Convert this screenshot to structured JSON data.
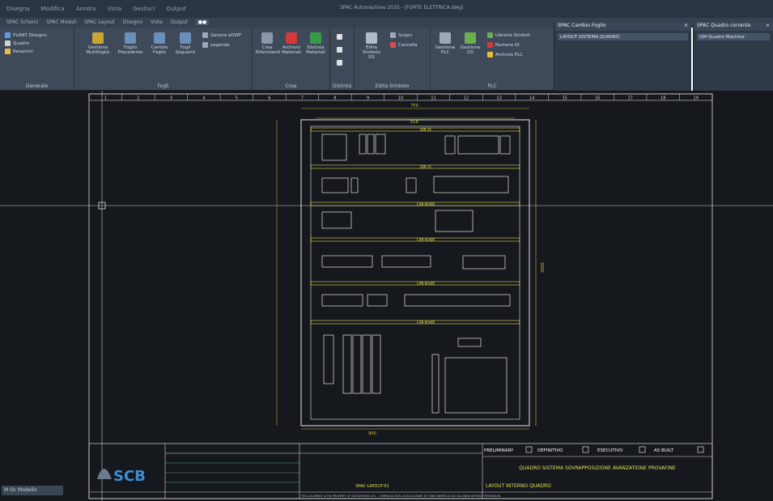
{
  "window": {
    "title": "SPAC Automazione 2025 - [FORTE ELETTRICA.dwg]",
    "quick_access": [
      "Disegna",
      "Modifica",
      "Annota",
      "Vista",
      "Gestisci",
      "Output"
    ]
  },
  "tabs": [
    "SPAC Schemi",
    "SPAC Moduli",
    "SPAC Layout",
    "Disegno",
    "Vista",
    "Output"
  ],
  "ribbon": {
    "groups": [
      {
        "label": "Generale",
        "items": [
          "PLANT Disegno",
          "Quadro",
          "Relazioni"
        ]
      },
      {
        "label": "Fogli",
        "items": [
          "Gestione Multifoglio",
          "Foglio Precedente",
          "Cambio Foglio",
          "Fogli Seguenti",
          "Genera eDWF",
          "Legenda"
        ]
      },
      {
        "label": "Crea",
        "items": [
          "Crea Riferimenti",
          "Archivio Materiali",
          "Distinta Materiali"
        ]
      },
      {
        "label": "Distinta",
        "items": []
      },
      {
        "label": "Edita Simbolo",
        "items": [
          "Edita Simbolo DS",
          "Scopri",
          "Cancella"
        ]
      },
      {
        "label": "PLC",
        "items": [
          "Gestione PLC",
          "Gestione I/O",
          "Libreria Simboli",
          "Numera IO",
          "Archivio PLC"
        ]
      }
    ]
  },
  "palettes": {
    "cambio_foglio": {
      "title": "SPAC Cambio Foglio",
      "field": "LAYOUT SISTEMA QUADRO"
    },
    "quadro_corrente": {
      "title": "SPAC Quadro corrente",
      "field": "QM Quadro Machine"
    }
  },
  "drawing": {
    "top_ruler": [
      "1",
      "2",
      "3",
      "4",
      "5",
      "6",
      "7",
      "8",
      "9",
      "10",
      "11",
      "12",
      "13",
      "14",
      "15",
      "16",
      "17",
      "18",
      "19"
    ],
    "dims": {
      "top": "750",
      "inner": "618",
      "bottom": "950",
      "right": "2000"
    },
    "rail_labels": [
      "DIN 35",
      "DIN 35",
      "DIN 35",
      "DIN 35",
      "DIN 35",
      "DIN 35"
    ],
    "canali": [
      "CAN 60x80",
      "CAN 60x80",
      "CAN 60x80",
      "CAN 60x80"
    ]
  },
  "title_block": {
    "company": "SCB",
    "status": [
      "PRELIMINARY",
      "DEFINITIVO",
      "ESECUTIVO",
      "AS BUILT"
    ],
    "project": "QUADRO SISTEMA SOVRAPPOSIZIONE AVANZATIONE PROVAFINE",
    "sheet": "LAYOUT INTERNO QUADRO",
    "document_code": "SPAC-LAYOUT-01",
    "footer": "THIS DOCUMENT IS THE PROPERTY OF SCB SYSTEMS S.R.L. - REPRODUCTION OR DISCLOSURE TO THIRD PARTIES IS NOT ALLOWED WITHOUT PERMISSION"
  },
  "statusbar": {
    "layout_tab": "M Oc Modello"
  },
  "colors": {
    "canvas": "#15181d",
    "lines": "#e6e6e6",
    "yellow": "#e8e250",
    "dim": "#c9c34a"
  }
}
